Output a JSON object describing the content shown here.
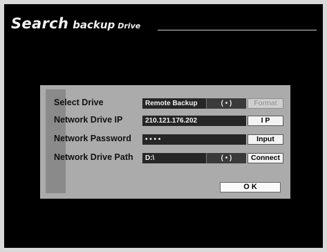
{
  "header": {
    "title_main": "Search",
    "title_sub": "backup",
    "title_tail": "Drive"
  },
  "form": {
    "select_drive": {
      "label": "Select Drive",
      "value": "Remote Backup",
      "toggle_icon": "( • )",
      "button": "Format"
    },
    "network_ip": {
      "label": "Network Drive IP",
      "value": "210.121.176.202",
      "button": "I P"
    },
    "network_password": {
      "label": "Network Password",
      "value": "• • • •",
      "button": "Input"
    },
    "network_path": {
      "label": "Network Drive Path",
      "value": "D:\\",
      "toggle_icon": "( • )",
      "button": "Connect"
    },
    "ok_button": "O K"
  }
}
